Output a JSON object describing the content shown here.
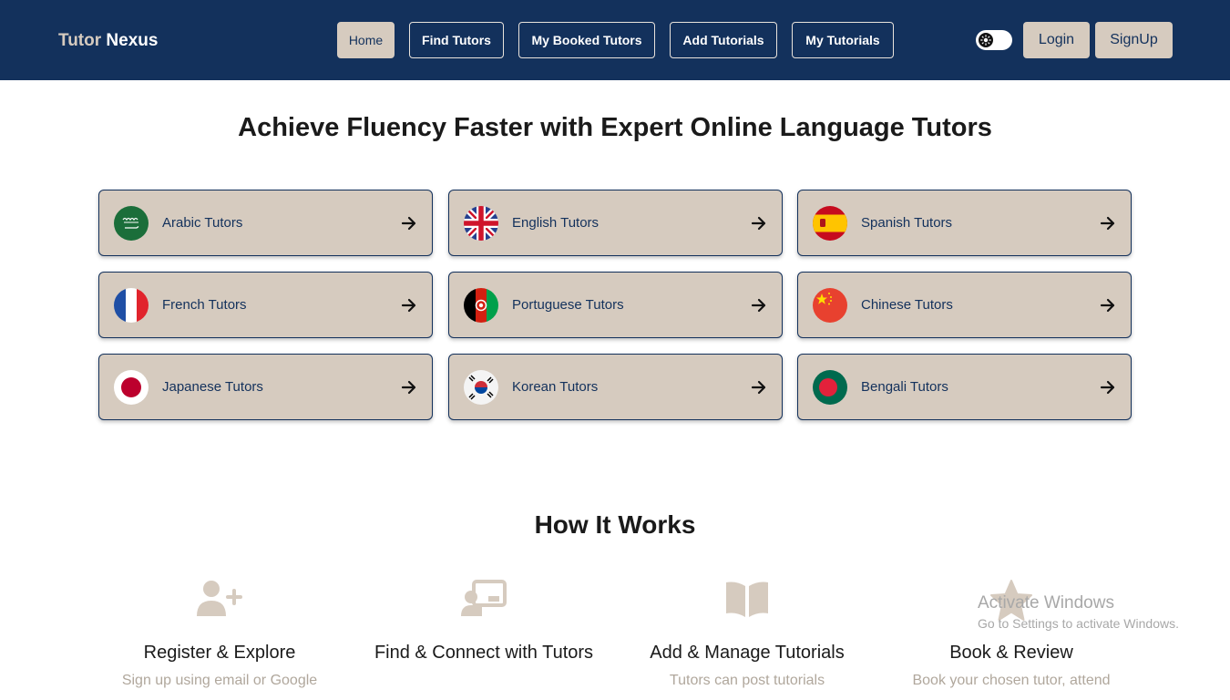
{
  "brand": {
    "part1": "Tutor",
    "part2": "Nexus"
  },
  "nav": {
    "home": "Home",
    "find_tutors": "Find Tutors",
    "my_booked_tutors": "My Booked Tutors",
    "add_tutorials": "Add Tutorials",
    "my_tutorials": "My Tutorials"
  },
  "auth": {
    "login": "Login",
    "signup": "SignUp"
  },
  "hero": {
    "title": "Achieve Fluency Faster with Expert Online Language Tutors"
  },
  "languages": [
    {
      "label": "Arabic Tutors",
      "icon": "saudi-flag-icon"
    },
    {
      "label": "English Tutors",
      "icon": "uk-flag-icon"
    },
    {
      "label": "Spanish Tutors",
      "icon": "spain-flag-icon"
    },
    {
      "label": "French Tutors",
      "icon": "france-flag-icon"
    },
    {
      "label": "Portuguese Tutors",
      "icon": "afghanistan-flag-icon"
    },
    {
      "label": "Chinese Tutors",
      "icon": "china-flag-icon"
    },
    {
      "label": "Japanese Tutors",
      "icon": "japan-flag-icon"
    },
    {
      "label": "Korean Tutors",
      "icon": "korea-flag-icon"
    },
    {
      "label": "Bengali Tutors",
      "icon": "bangladesh-flag-icon"
    }
  ],
  "how_it_works": {
    "title": "How It Works",
    "steps": [
      {
        "title": "Register & Explore",
        "desc": "Sign up using email or Google",
        "icon": "user-plus-icon"
      },
      {
        "title": "Find & Connect with Tutors",
        "desc": "",
        "icon": "chalkboard-teacher-icon"
      },
      {
        "title": "Add & Manage Tutorials",
        "desc": "Tutors can post tutorials",
        "icon": "open-book-icon"
      },
      {
        "title": "Book & Review",
        "desc": "Book your chosen tutor, attend",
        "icon": "star-icon"
      }
    ]
  },
  "watermark": {
    "line1": "Activate Windows",
    "line2": "Go to Settings to activate Windows."
  },
  "colors": {
    "navbar": "#13315c",
    "accent": "#d6cbbf",
    "muted_text": "#b0a79c"
  }
}
